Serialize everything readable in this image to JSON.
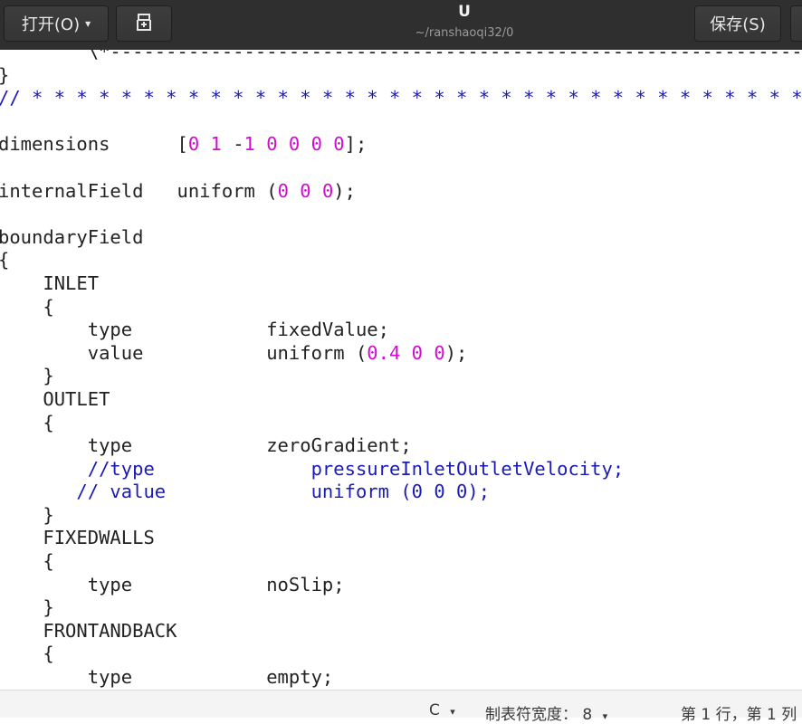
{
  "header": {
    "open_label": "打开(O)",
    "open_caret": "▾",
    "new_icon": "new-document-icon",
    "title": "U",
    "subtitle": "~/ranshaoqi32/0",
    "save_label": "保存(S)"
  },
  "editor": {
    "lines": [
      [
        "        \\*---------------------------------------------------------------------------*/"
      ],
      [
        "}"
      ],
      [
        {
          "t": "// * * * * * * * * * * * * * * * * * * * * * * * * * * * * * * * * * * * * //",
          "k": "c"
        }
      ],
      [
        ""
      ],
      [
        "dimensions      [",
        {
          "t": "0",
          "k": "n"
        },
        " ",
        {
          "t": "1",
          "k": "n"
        },
        " -",
        {
          "t": "1",
          "k": "n"
        },
        " ",
        {
          "t": "0",
          "k": "n"
        },
        " ",
        {
          "t": "0",
          "k": "n"
        },
        " ",
        {
          "t": "0",
          "k": "n"
        },
        " ",
        {
          "t": "0",
          "k": "n"
        },
        "];"
      ],
      [
        ""
      ],
      [
        "internalField   uniform (",
        {
          "t": "0",
          "k": "n"
        },
        " ",
        {
          "t": "0",
          "k": "n"
        },
        " ",
        {
          "t": "0",
          "k": "n"
        },
        ");"
      ],
      [
        ""
      ],
      [
        "boundaryField"
      ],
      [
        "{"
      ],
      [
        "    INLET"
      ],
      [
        "    {"
      ],
      [
        "        type            fixedValue;"
      ],
      [
        "        value           uniform (",
        {
          "t": "0.4",
          "k": "n"
        },
        " ",
        {
          "t": "0",
          "k": "n"
        },
        " ",
        {
          "t": "0",
          "k": "n"
        },
        ");"
      ],
      [
        "    }"
      ],
      [
        "    OUTLET"
      ],
      [
        "    {"
      ],
      [
        "        type            zeroGradient;"
      ],
      [
        "        ",
        {
          "t": "//type              pressureInletOutletVelocity;",
          "k": "c"
        }
      ],
      [
        "       ",
        {
          "t": "// value             uniform (0 0 0);",
          "k": "c"
        }
      ],
      [
        "    }"
      ],
      [
        "    FIXEDWALLS"
      ],
      [
        "    {"
      ],
      [
        "        type            noSlip;"
      ],
      [
        "    }"
      ],
      [
        "    FRONTANDBACK"
      ],
      [
        "    {"
      ],
      [
        "        type            empty;"
      ],
      [
        "    }"
      ]
    ]
  },
  "statusbar": {
    "language": "C",
    "tab_width_label": "制表符宽度：",
    "tab_width_value": "8",
    "position": "第 1 行，第 1 列",
    "caret": "▾"
  }
}
